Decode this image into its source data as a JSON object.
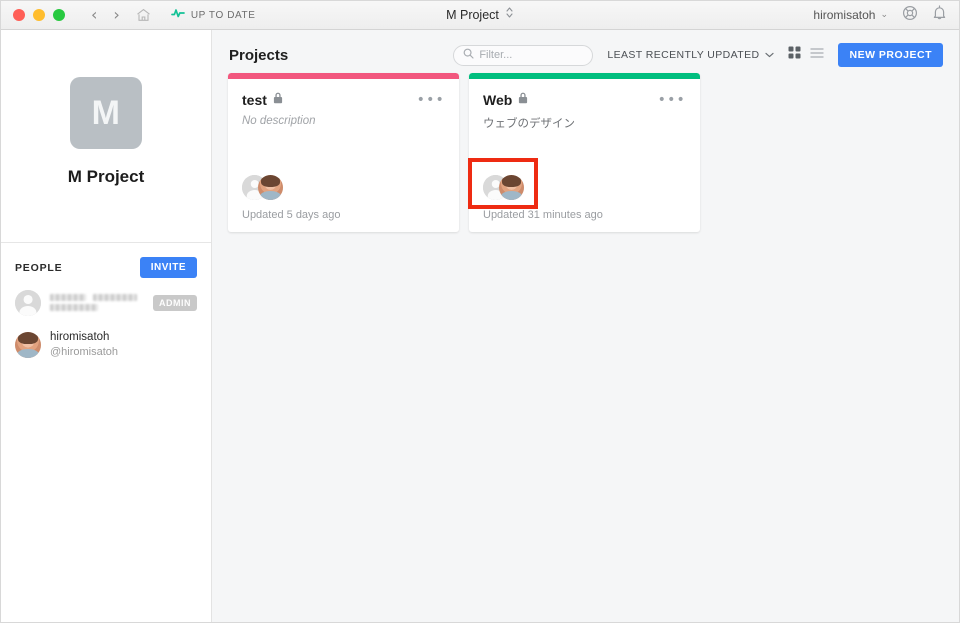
{
  "titlebar": {
    "window_controls": [
      "close",
      "minimize",
      "maximize"
    ],
    "back_glyph": "‹",
    "forward_glyph": "›",
    "home_icon": "home-icon",
    "sync_status": "UP TO DATE",
    "sync_icon": "activity-pulse-icon",
    "project_title": "M Project",
    "project_switcher_icon": "up-down-chevron-icon",
    "user_name": "hiromisatoh",
    "user_chevron": "⌄",
    "help_icon": "life-preserver-icon",
    "notifications_icon": "bell-icon"
  },
  "sidebar": {
    "project_initial": "M",
    "project_name": "M Project",
    "people": {
      "title": "PEOPLE",
      "invite_label": "INVITE",
      "members": [
        {
          "name": "",
          "handle": "",
          "redacted": true,
          "badge": "ADMIN",
          "avatar": "placeholder-avatar"
        },
        {
          "name": "hiromisatoh",
          "handle": "@hiromisatoh",
          "redacted": false,
          "badge": "",
          "avatar": "photo-avatar"
        }
      ]
    }
  },
  "main": {
    "page_title": "Projects",
    "filter": {
      "placeholder": "Filter...",
      "value": "",
      "icon": "search-icon"
    },
    "sort": {
      "label": "LEAST RECENTLY UPDATED",
      "chevron": "⌄"
    },
    "view_toggles": {
      "grid_icon": "grid-view-icon",
      "list_icon": "list-view-icon",
      "active": "grid"
    },
    "new_project_label": "NEW PROJECT",
    "cards": [
      {
        "title": "test",
        "lock_icon": "lock-icon",
        "menu_icon": "ellipsis-icon",
        "description": "No description",
        "description_is_placeholder": true,
        "stripe_color": "#f2577e",
        "avatars": [
          "placeholder-avatar",
          "photo-avatar"
        ],
        "updated": "Updated 5 days ago",
        "highlighted": false
      },
      {
        "title": "Web",
        "lock_icon": "lock-icon",
        "menu_icon": "ellipsis-icon",
        "description": "ウェブのデザイン",
        "description_is_placeholder": false,
        "stripe_color": "#00be7e",
        "avatars": [
          "placeholder-avatar",
          "photo-avatar"
        ],
        "updated": "Updated 31 minutes ago",
        "highlighted": true
      }
    ]
  },
  "annotation": {
    "highlight_color": "#ee2b12",
    "target": "card-avatars-web"
  },
  "colors": {
    "accent_blue": "#3b82f6",
    "card_pink": "#f2577e",
    "card_green": "#00be7e",
    "sync_green": "#13c296",
    "main_bg": "#f5f6f7"
  }
}
